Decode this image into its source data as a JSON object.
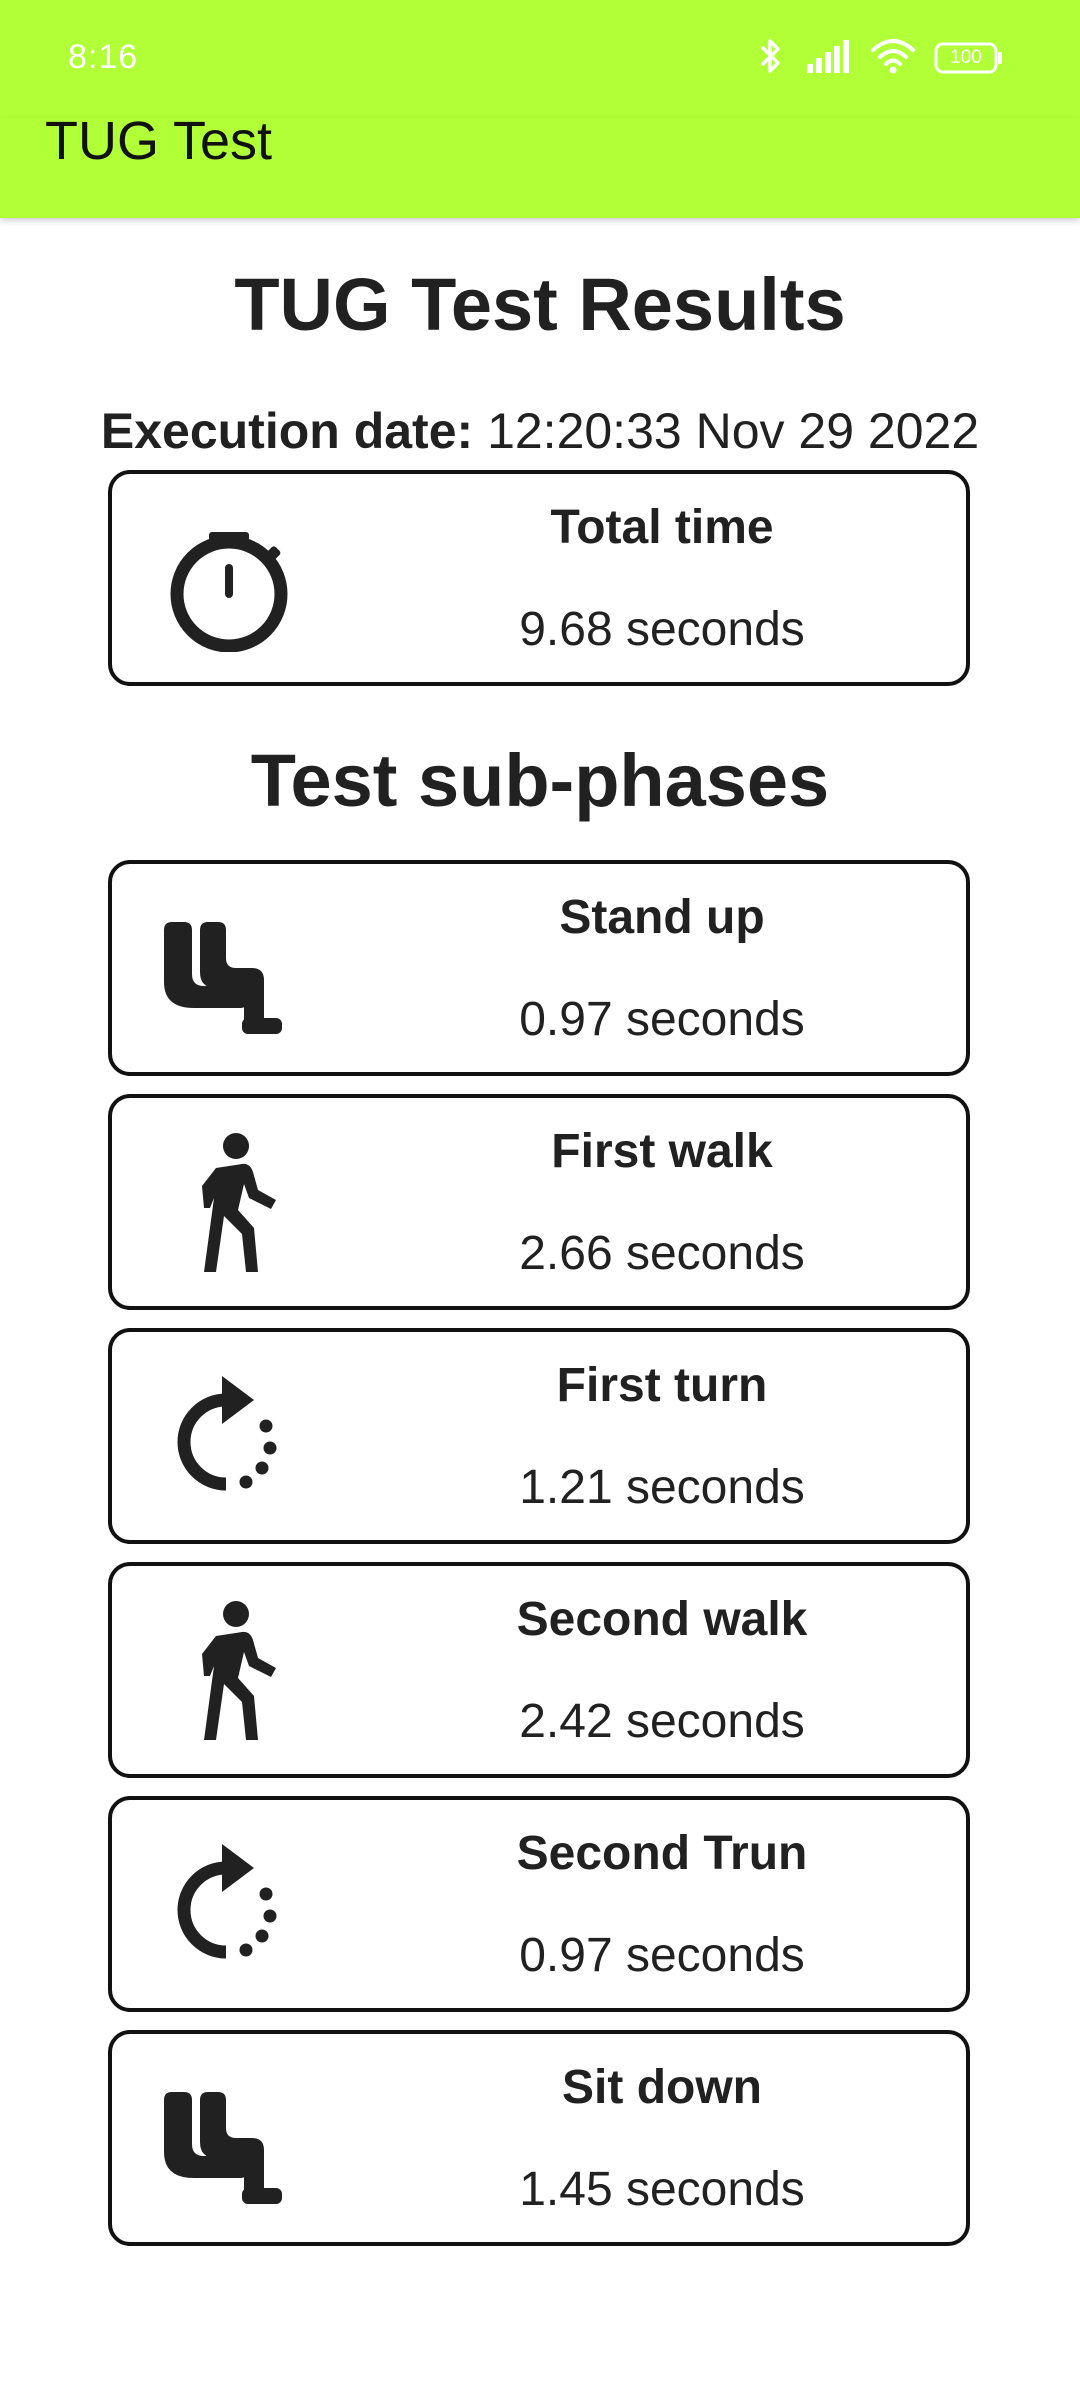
{
  "status_bar": {
    "time": "8:16",
    "icons": [
      "bluetooth-icon",
      "signal-icon",
      "wifi-icon",
      "battery-icon"
    ],
    "battery_level": "100"
  },
  "app_bar": {
    "title": "TUG Test",
    "color": "#b0ff37"
  },
  "main": {
    "title": "TUG Test Results",
    "execution_label": "Execution date:",
    "execution_value": "12:20:33 Nov 29 2022",
    "total": {
      "label": "Total time",
      "value": "9.68 seconds",
      "icon": "stopwatch-icon"
    },
    "subphases_title": "Test sub-phases",
    "phases": [
      {
        "label": "Stand up",
        "value": "0.97 seconds",
        "icon": "chair-icon"
      },
      {
        "label": "First walk",
        "value": "2.66 seconds",
        "icon": "walking-person-icon"
      },
      {
        "label": "First turn",
        "value": "1.21 seconds",
        "icon": "rotate-icon"
      },
      {
        "label": "Second walk",
        "value": "2.42 seconds",
        "icon": "walking-person-icon"
      },
      {
        "label": "Second Trun",
        "value": "0.97 seconds",
        "icon": "rotate-icon"
      },
      {
        "label": "Sit down",
        "value": "1.45 seconds",
        "icon": "chair-icon"
      }
    ]
  }
}
